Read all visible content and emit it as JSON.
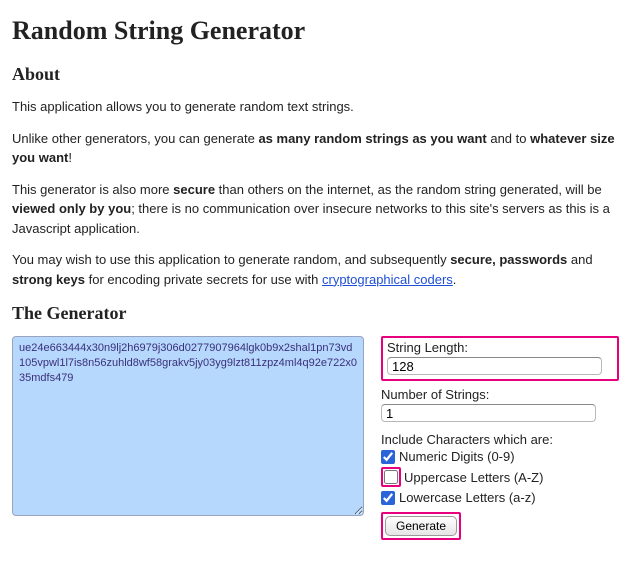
{
  "title": "Random String Generator",
  "about": {
    "heading": "About",
    "p1": "This application allows you to generate random text strings.",
    "p2_a": "Unlike other generators, you can generate ",
    "p2_b": "as many random strings as you want",
    "p2_c": " and to ",
    "p2_d": "whatever size you want",
    "p2_e": "!",
    "p3_a": "This generator is also more ",
    "p3_b": "secure",
    "p3_c": " than others on the internet, as the random string generated, will be ",
    "p3_d": "viewed only by you",
    "p3_e": "; there is no communication over insecure networks to this site's servers as this is a Javascript application.",
    "p4_a": "You may wish to use this application to generate random, and subsequently ",
    "p4_b": "secure, passwords",
    "p4_c": " and ",
    "p4_d": "strong keys",
    "p4_e": " for encoding private secrets for use with ",
    "p4_link": "cryptographical coders",
    "p4_f": "."
  },
  "generator": {
    "heading": "The Generator",
    "output_value": "ue24e663444x30n9lj2h6979j306d0277907964lgk0b9x2shal1pn73vd105vpwl1l7is8n56zuhld8wf58grakv5jy03yg9lzt811zpz4ml4q92e722x035mdfs479",
    "length_label": "String Length:",
    "length_value": "128",
    "count_label": "Number of Strings:",
    "count_value": "1",
    "include_label": "Include Characters which are:",
    "numeric_label": "Numeric Digits (0-9)",
    "numeric_checked": true,
    "upper_label": "Uppercase Letters (A-Z)",
    "upper_checked": false,
    "lower_label": "Lowercase Letters (a-z)",
    "lower_checked": true,
    "button_label": "Generate"
  }
}
